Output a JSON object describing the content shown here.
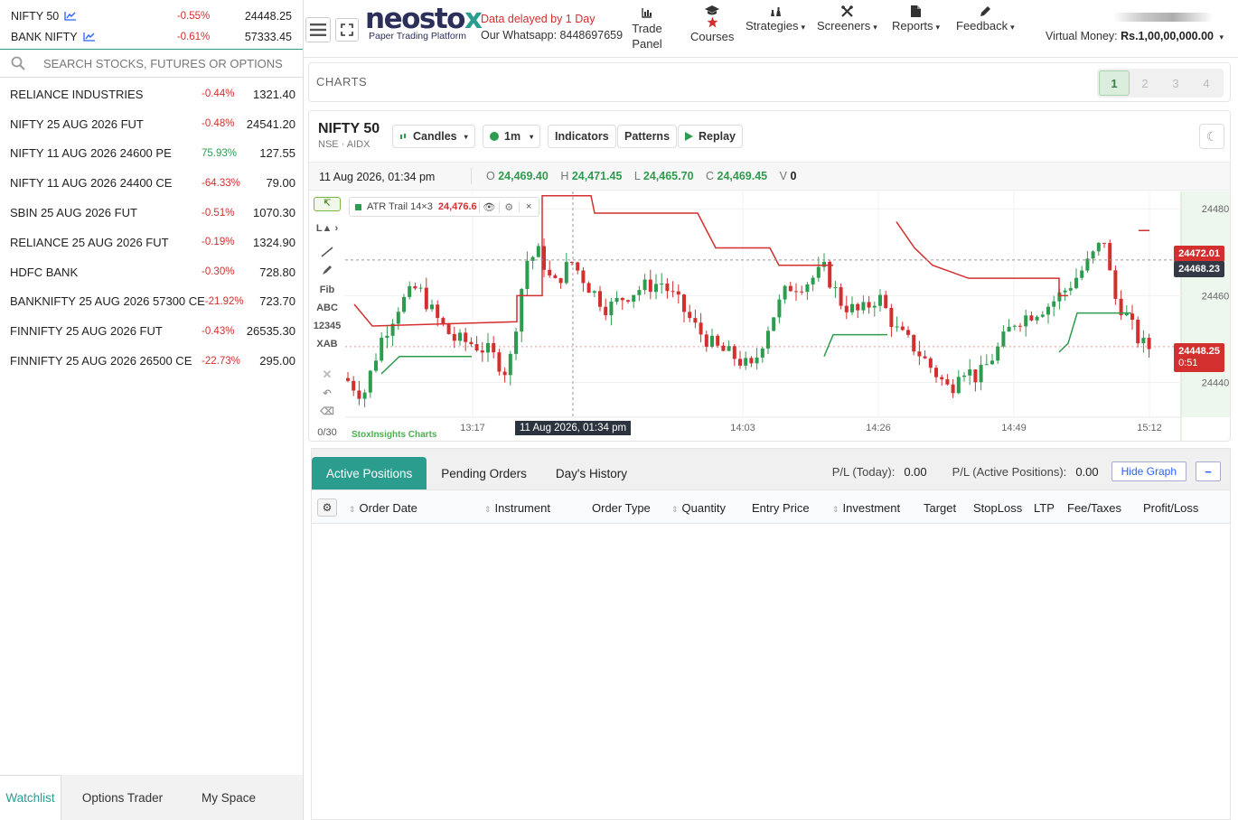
{
  "indices": [
    {
      "name": "NIFTY 50",
      "change": "-0.55%",
      "value": "24448.25"
    },
    {
      "name": "BANK NIFTY",
      "change": "-0.61%",
      "value": "57333.45"
    }
  ],
  "search": {
    "placeholder": "SEARCH STOCKS, FUTURES OR OPTIONS"
  },
  "watchlist": [
    {
      "name": "RELIANCE INDUSTRIES",
      "change": "-0.44%",
      "ltp": "1321.40",
      "dir": "neg"
    },
    {
      "name": "NIFTY 25 AUG 2026 FUT",
      "change": "-0.48%",
      "ltp": "24541.20",
      "dir": "neg"
    },
    {
      "name": "NIFTY 11 AUG 2026 24600 PE",
      "change": "75.93%",
      "ltp": "127.55",
      "dir": "pos"
    },
    {
      "name": "NIFTY 11 AUG 2026 24400 CE",
      "change": "-64.33%",
      "ltp": "79.00",
      "dir": "neg"
    },
    {
      "name": "SBIN 25 AUG 2026 FUT",
      "change": "-0.51%",
      "ltp": "1070.30",
      "dir": "neg"
    },
    {
      "name": "RELIANCE 25 AUG 2026 FUT",
      "change": "-0.19%",
      "ltp": "1324.90",
      "dir": "neg"
    },
    {
      "name": "HDFC BANK",
      "change": "-0.30%",
      "ltp": "728.80",
      "dir": "neg"
    },
    {
      "name": "BANKNIFTY 25 AUG 2026 57300 CE",
      "change": "-21.92%",
      "ltp": "723.70",
      "dir": "neg"
    },
    {
      "name": "FINNIFTY 25 AUG 2026 FUT",
      "change": "-0.43%",
      "ltp": "26535.30",
      "dir": "neg"
    },
    {
      "name": "FINNIFTY 25 AUG 2026 26500 CE",
      "change": "-22.73%",
      "ltp": "295.00",
      "dir": "neg"
    }
  ],
  "left_tabs": [
    "Watchlist",
    "Options Trader",
    "My Space"
  ],
  "header": {
    "brand_main": "neosto",
    "brand_x": "x",
    "tagline": "Paper Trading Platform",
    "delay_text": "Data delayed by 1 Day",
    "whatsapp_text": "Our Whatsapp: 8448697659",
    "nav": {
      "trade_panel_1": "Trade",
      "trade_panel_2": "Panel",
      "courses": "Courses",
      "strategies": "Strategies",
      "screeners": "Screeners",
      "reports": "Reports",
      "feedback": "Feedback"
    },
    "virtual_money_label": "Virtual Money:",
    "virtual_money_value": "Rs.1,00,00,000.00"
  },
  "charts_bar": {
    "title": "CHARTS",
    "layouts": [
      "1",
      "2",
      "3",
      "4"
    ]
  },
  "chart": {
    "symbol": "NIFTY 50",
    "exchange": "NSE · AIDX",
    "toolbar": {
      "chart_type": "Candles",
      "interval": "1m",
      "indicators": "Indicators",
      "patterns": "Patterns",
      "replay": "Replay"
    },
    "ohlc": {
      "datetime": "11 Aug 2026, 01:34 pm",
      "o_label": "O",
      "o": "24,469.40",
      "h_label": "H",
      "h": "24,471.45",
      "l_label": "L",
      "l": "24,465.70",
      "c_label": "C",
      "c": "24,469.45",
      "v_label": "V",
      "v": "0"
    },
    "indicator": {
      "name": "ATR Trail 14×3",
      "value": "24,476.6"
    },
    "side_tools": {
      "fib": "Fib",
      "abc": "ABC",
      "nums": "12345",
      "xab": "XAB",
      "count": "0/30"
    },
    "price_labels": {
      "red": "24472.01",
      "dark": "24468.23",
      "last": "24448.25",
      "countdown": "0:51"
    },
    "crosshair_time": "11 Aug 2026, 01:34 pm",
    "watermark": "StoxInsights Charts",
    "colors": {
      "up": "#2e9c4f",
      "down": "#d32f2f",
      "trail_up": "#2e9c4f",
      "trail_down": "#d32f2f"
    }
  },
  "chart_data": {
    "type": "candlestick",
    "xlabel": "",
    "ylabel": "",
    "x_ticks": [
      "13:17",
      "14:03",
      "14:26",
      "14:49",
      "15:12"
    ],
    "y_ticks": [
      "24480",
      "24460",
      "24440"
    ],
    "ylim": [
      24432,
      24484
    ],
    "series": [
      {
        "name": "ATR Trail 14×3",
        "values": []
      }
    ]
  },
  "bottom": {
    "tabs": [
      "Active Positions",
      "Pending Orders",
      "Day's History"
    ],
    "pl_today_label": "P/L (Today):",
    "pl_today_value": "0.00",
    "pl_active_label": "P/L (Active Positions):",
    "pl_active_value": "0.00",
    "hide_graph": "Hide Graph",
    "minus": "−",
    "columns": [
      "Order Date",
      "Instrument",
      "Order Type",
      "Quantity",
      "Entry Price",
      "Investment",
      "Target",
      "StopLoss",
      "LTP",
      "Fee/Taxes",
      "Profit/Loss"
    ]
  }
}
